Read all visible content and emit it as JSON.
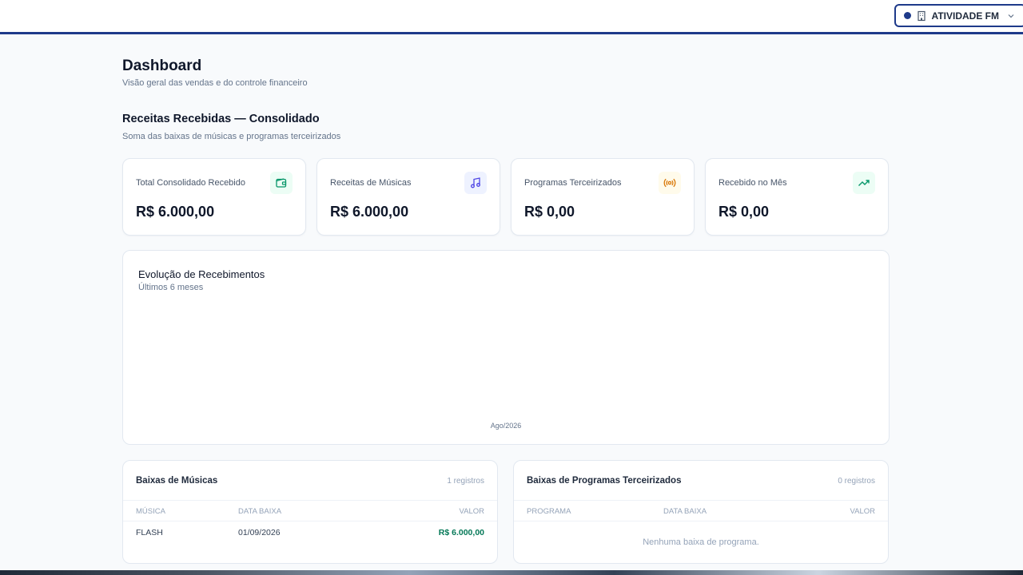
{
  "header": {
    "station_label": "ATIVIDADE FM"
  },
  "page": {
    "title": "Dashboard",
    "subtitle": "Visão geral das vendas e do controle financeiro"
  },
  "section": {
    "title": "Receitas Recebidas — Consolidado",
    "subtitle": "Soma das baixas de músicas e programas terceirizados"
  },
  "cards": [
    {
      "label": "Total Consolidado Recebido",
      "value": "R$ 6.000,00",
      "icon": "wallet-icon",
      "color": "#059669",
      "bg": "#ecfdf5"
    },
    {
      "label": "Receitas de Músicas",
      "value": "R$ 6.000,00",
      "icon": "music-icon",
      "color": "#4f46e5",
      "bg": "#eef2ff"
    },
    {
      "label": "Programas Terceirizados",
      "value": "R$ 0,00",
      "icon": "broadcast-icon",
      "color": "#d97706",
      "bg": "#fffbeb"
    },
    {
      "label": "Recebido no Mês",
      "value": "R$ 0,00",
      "icon": "trending-up-icon",
      "color": "#059669",
      "bg": "#ecfdf5"
    }
  ],
  "chart": {
    "title": "Evolução de Recebimentos",
    "subtitle": "Últimos 6 meses"
  },
  "chart_data": {
    "type": "bar",
    "categories": [
      "Ago/2026"
    ],
    "series": [
      {
        "values": [
          0
        ]
      }
    ],
    "xlabel": "",
    "ylabel": "",
    "grid": false
  },
  "music_table": {
    "title": "Baixas de Músicas",
    "count": "1 registros",
    "columns": [
      "MÚSICA",
      "DATA BAIXA",
      "VALOR"
    ],
    "rows": [
      [
        "FLASH",
        "01/09/2026",
        "R$ 6.000,00"
      ]
    ]
  },
  "program_table": {
    "title": "Baixas de Programas Terceirizados",
    "count": "0 registros",
    "columns": [
      "PROGRAMA",
      "DATA BAIXA",
      "VALOR"
    ],
    "empty_text": "Nenhuma baixa de programa."
  }
}
